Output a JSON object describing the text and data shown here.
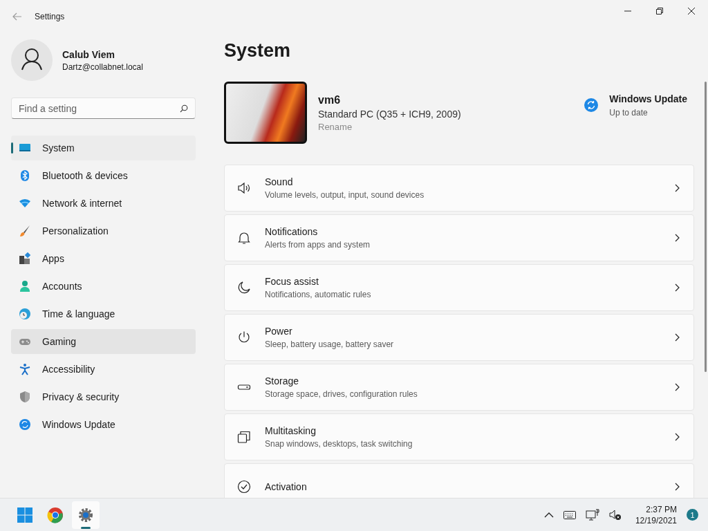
{
  "window": {
    "title": "Settings"
  },
  "profile": {
    "name": "Calub Viem",
    "email": "Dartz@collabnet.local"
  },
  "search": {
    "placeholder": "Find a setting"
  },
  "sidebar": {
    "items": [
      {
        "label": "System",
        "selected": true,
        "hovered": false
      },
      {
        "label": "Bluetooth & devices",
        "selected": false,
        "hovered": false
      },
      {
        "label": "Network & internet",
        "selected": false,
        "hovered": false
      },
      {
        "label": "Personalization",
        "selected": false,
        "hovered": false
      },
      {
        "label": "Apps",
        "selected": false,
        "hovered": false
      },
      {
        "label": "Accounts",
        "selected": false,
        "hovered": false
      },
      {
        "label": "Time & language",
        "selected": false,
        "hovered": false
      },
      {
        "label": "Gaming",
        "selected": false,
        "hovered": true
      },
      {
        "label": "Accessibility",
        "selected": false,
        "hovered": false
      },
      {
        "label": "Privacy & security",
        "selected": false,
        "hovered": false
      },
      {
        "label": "Windows Update",
        "selected": false,
        "hovered": false
      }
    ]
  },
  "page": {
    "title": "System"
  },
  "device": {
    "name": "vm6",
    "model": "Standard PC (Q35 + ICH9, 2009)",
    "rename": "Rename"
  },
  "update": {
    "title": "Windows Update",
    "status": "Up to date"
  },
  "cards": [
    {
      "title": "Sound",
      "subtitle": "Volume levels, output, input, sound devices"
    },
    {
      "title": "Notifications",
      "subtitle": "Alerts from apps and system"
    },
    {
      "title": "Focus assist",
      "subtitle": "Notifications, automatic rules"
    },
    {
      "title": "Power",
      "subtitle": "Sleep, battery usage, battery saver"
    },
    {
      "title": "Storage",
      "subtitle": "Storage space, drives, configuration rules"
    },
    {
      "title": "Multitasking",
      "subtitle": "Snap windows, desktops, task switching"
    },
    {
      "title": "Activation"
    }
  ],
  "taskbar": {
    "apps": [
      {
        "selected": false
      },
      {
        "selected": false
      },
      {
        "selected": true
      }
    ],
    "time": "2:37 PM",
    "date": "12/19/2021",
    "notifications": "1"
  }
}
